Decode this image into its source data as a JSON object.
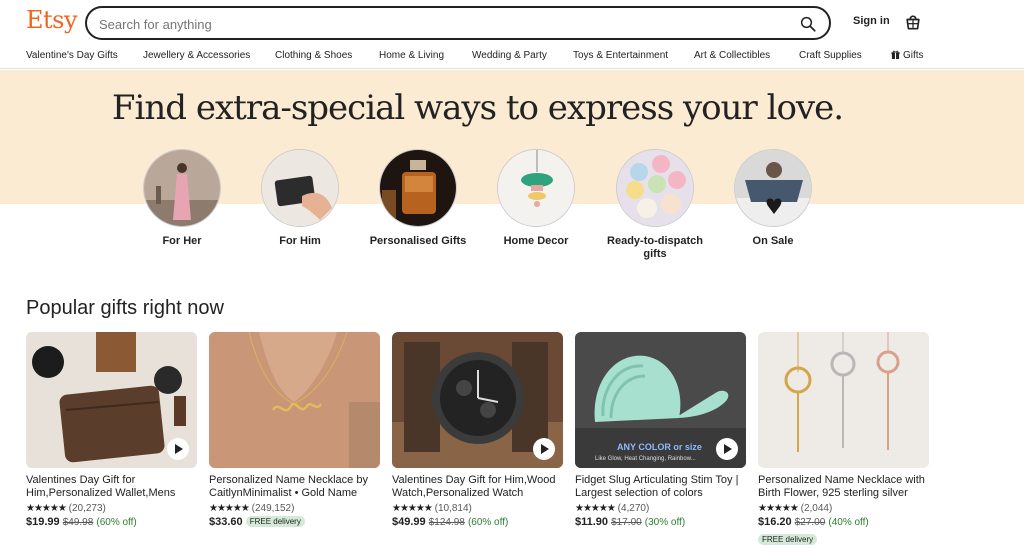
{
  "header": {
    "logo": "Etsy",
    "search_placeholder": "Search for anything",
    "signin": "Sign in"
  },
  "nav": [
    "Valentine's Day Gifts",
    "Jewellery & Accessories",
    "Clothing & Shoes",
    "Home & Living",
    "Wedding & Party",
    "Toys & Entertainment",
    "Art & Collectibles",
    "Craft Supplies",
    "Gifts"
  ],
  "hero": {
    "title": "Find extra-special ways to express your love.",
    "circles": [
      {
        "label": "For Her"
      },
      {
        "label": "For Him"
      },
      {
        "label": "Personalised Gifts"
      },
      {
        "label": "Home Decor"
      },
      {
        "label": "Ready-to-dispatch gifts"
      },
      {
        "label": "On Sale"
      }
    ]
  },
  "popular": {
    "title": "Popular gifts right now",
    "cards": [
      {
        "title": "Valentines Day Gift for Him,Personalized Wallet,Mens Wallet",
        "stars": "★★★★★",
        "reviews": "(20,273)",
        "price": "$19.99",
        "orig": "$49.98",
        "disc": "(60% off)",
        "free": ""
      },
      {
        "title": "Personalized Name Necklace by CaitlynMinimalist • Gold Name Necklace",
        "stars": "★★★★★",
        "reviews": "(249,152)",
        "price": "$33.60",
        "orig": "",
        "disc": "",
        "free": "FREE delivery"
      },
      {
        "title": "Valentines Day Gift for Him,Wood Watch,Personalized Watch",
        "stars": "★★★★★",
        "reviews": "(10,814)",
        "price": "$49.99",
        "orig": "$124.98",
        "disc": "(60% off)",
        "free": ""
      },
      {
        "title": "Fidget Slug Articulating Stim Toy | Largest selection of colors",
        "stars": "★★★★★",
        "reviews": "(4,270)",
        "price": "$11.90",
        "orig": "$17.00",
        "disc": "(30% off)",
        "free": ""
      },
      {
        "title": "Personalized Name Necklace with Birth Flower, 925 sterling silver",
        "stars": "★★★★★",
        "reviews": "(2,044)",
        "price": "$16.20",
        "orig": "$27.00",
        "disc": "(40% off)",
        "free": "FREE delivery"
      }
    ],
    "slug_caption_1": "ANY COLOR or size",
    "slug_caption_2": "Like Glow, Heat Changing, Rainbow..."
  },
  "colors": {
    "brand": "#F1641E",
    "hero_band": "#FCEBD3",
    "discount": "#2e7d32",
    "free_badge": "#d4e9d7"
  }
}
